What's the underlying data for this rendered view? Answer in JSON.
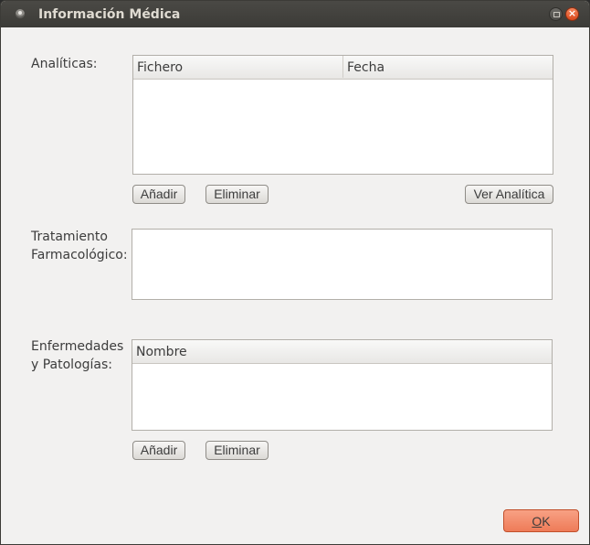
{
  "window": {
    "title": "Información Médica"
  },
  "analiticas": {
    "label": "Analíticas:",
    "columns": [
      "Fichero",
      "Fecha"
    ],
    "rows": [],
    "add_label": "Añadir",
    "remove_label": "Eliminar",
    "view_label": "Ver Analítica"
  },
  "tratamiento": {
    "label_line1": "Tratamiento",
    "label_line2": "Farmacológico:",
    "value": ""
  },
  "enfermedades": {
    "label_line1": "Enfermedades",
    "label_line2": "y Patologías:",
    "columns": [
      "Nombre"
    ],
    "rows": [],
    "add_label": "Añadir",
    "remove_label": "Eliminar"
  },
  "footer": {
    "ok_mnemonic": "O",
    "ok_rest": "K"
  },
  "colors": {
    "accent": "#ee7b58",
    "titlebar": "#3c3b37",
    "background": "#f2f1f0"
  }
}
